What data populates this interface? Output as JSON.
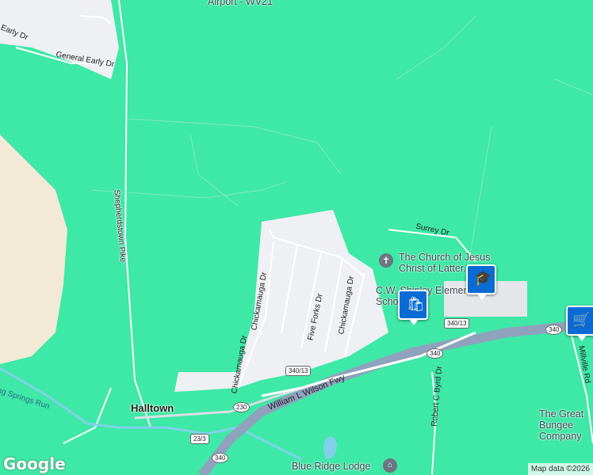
{
  "map": {
    "bg_color": "#3ee8a6",
    "road_color": "#ffffff",
    "urban_color": "#eef0f3",
    "highway_color": "#8fa2bd"
  },
  "top_poi": "Airport - WV21",
  "streets": {
    "early_dr": "Early Dr",
    "general_early_dr": "General Early Dr",
    "shepherdstown_pike": "Shepherdstown Pike",
    "surrey_dr": "Surrey Dr",
    "chickamauga_dr_1": "Chickamauga Dr",
    "chickamauga_dr_2": "Chickamauga Dr",
    "chickamauga_dr_3": "Chickamauga Dr",
    "five_forks_dr": "Five Forks Dr",
    "william_wilson_fwy": "William L Wilson Fwy",
    "robert_byrd_dr": "Robert C Byrd Dr",
    "millville_rd": "Millville Rd",
    "springs_run": "ng Springs Run"
  },
  "pois": {
    "church": "The Church of Jesus Christ of Latter...",
    "school": "C.W. Shipley Elementary School",
    "bungee": "The Great Bungee Company",
    "lodge": "Blue Ridge Lodge"
  },
  "places": {
    "halltown": "Halltown"
  },
  "shields": {
    "r340_13_a": "340/13",
    "r340_13_b": "340/13",
    "r340_a": "340",
    "r340_b": "340",
    "r340_c": "340",
    "r230": "230",
    "r23_3": "23/3"
  },
  "branding": {
    "logo": "Google",
    "attribution": "Map data ©2026"
  }
}
